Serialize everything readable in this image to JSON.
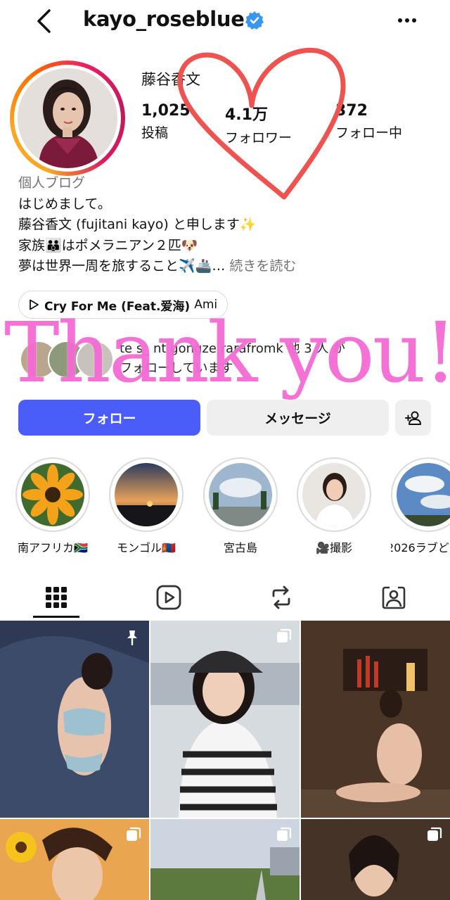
{
  "header": {
    "username": "kayo_roseblue"
  },
  "profile": {
    "full_name": "藤谷香文",
    "stats": [
      {
        "value": "1,025",
        "label": "投稿"
      },
      {
        "value": "4.1万",
        "label": "フォロワー"
      },
      {
        "value": "372",
        "label": "フォロー中"
      }
    ]
  },
  "bio": {
    "category": "個人ブログ",
    "lines": [
      "はじめまして。",
      "藤谷香文 (fujitani kayo) と申します✨",
      "家族👪はポメラニアン２匹🐶",
      "夢は世界一周を旅すること✈️🚢…"
    ],
    "more": "続きを読む"
  },
  "music": {
    "title": "Cry For Me (Feat.爱海)",
    "artist": "Ami"
  },
  "followed_by": {
    "line1": "te      s_      nt     gongze    rarafromk    他 3 人 が",
    "line2": "フォローしています"
  },
  "overlay": {
    "text": "Thank you!",
    "heart_color": "#ef5350",
    "text_color": "#f46bd4"
  },
  "actions": {
    "follow": "フォロー",
    "message": "メッセージ"
  },
  "highlights": [
    {
      "label": "南アフリカ🇿🇦"
    },
    {
      "label": "モンゴル🇲🇳"
    },
    {
      "label": "宮古島"
    },
    {
      "label": "🎥撮影"
    },
    {
      "label": "2026ラブど"
    }
  ],
  "colors": {
    "accent": "#4a5df9",
    "button_gray": "#efefef",
    "verified": "#3897f0"
  }
}
